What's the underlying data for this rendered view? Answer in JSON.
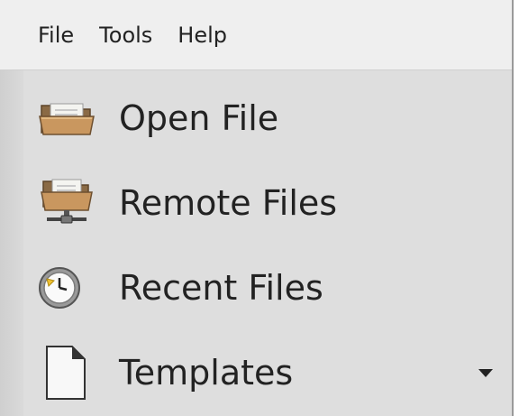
{
  "menubar": {
    "items": [
      {
        "label": "File"
      },
      {
        "label": "Tools"
      },
      {
        "label": "Help"
      }
    ]
  },
  "start_center": {
    "items": [
      {
        "label": "Open File",
        "icon": "folder-open-icon"
      },
      {
        "label": "Remote Files",
        "icon": "remote-folder-icon"
      },
      {
        "label": "Recent Files",
        "icon": "clock-icon"
      },
      {
        "label": "Templates",
        "icon": "document-template-icon",
        "has_dropdown": true
      }
    ]
  },
  "colors": {
    "background": "#dedede",
    "menubar_bg": "#efefef",
    "text": "#222222",
    "folder": "#b8895a"
  }
}
